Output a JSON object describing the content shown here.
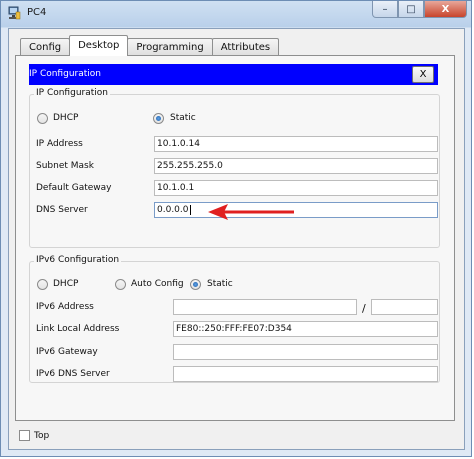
{
  "window": {
    "title": "PC4",
    "controls": {
      "minimize": "–",
      "maximize": "□",
      "close": "X"
    }
  },
  "tabs": [
    "Config",
    "Desktop",
    "Programming",
    "Attributes"
  ],
  "active_tab": "Desktop",
  "ip_panel": {
    "header": "IP Configuration",
    "close_label": "X",
    "ipv4": {
      "title": "IP Configuration",
      "dhcp_label": "DHCP",
      "static_label": "Static",
      "selected": "Static",
      "fields": {
        "ip_address": {
          "label": "IP Address",
          "value": "10.1.0.14"
        },
        "subnet_mask": {
          "label": "Subnet Mask",
          "value": "255.255.255.0"
        },
        "default_gateway": {
          "label": "Default Gateway",
          "value": "10.1.0.1"
        },
        "dns_server": {
          "label": "DNS Server",
          "value": "0.0.0.0"
        }
      }
    },
    "ipv6": {
      "title": "IPv6 Configuration",
      "dhcp_label": "DHCP",
      "auto_label": "Auto Config",
      "static_label": "Static",
      "selected": "Static",
      "fields": {
        "address": {
          "label": "IPv6 Address",
          "value": "",
          "prefix": ""
        },
        "prefix_separator": "/",
        "link_local": {
          "label": "Link Local Address",
          "value": "FE80::250:FFF:FE07:D354"
        },
        "gateway": {
          "label": "IPv6 Gateway",
          "value": ""
        },
        "dns": {
          "label": "IPv6 DNS Server",
          "value": ""
        }
      }
    }
  },
  "top_checkbox": {
    "label": "Top",
    "checked": false
  },
  "annotation_arrow_color": "#e02020"
}
